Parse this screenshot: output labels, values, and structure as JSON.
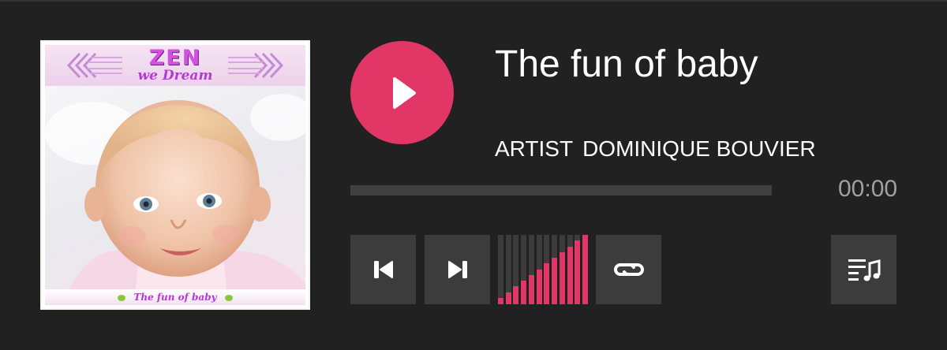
{
  "track": {
    "title": "The fun of baby",
    "artist_label": "ARTIST",
    "artist_name": "DOMINIQUE BOUVIER",
    "time": "00:00",
    "progress": 0
  },
  "cover": {
    "brand_line1": "ZEN",
    "brand_line2": "we Dream",
    "footer_text": "The fun of baby"
  },
  "controls": {
    "play_icon": "play-icon",
    "prev_icon": "skip-previous-icon",
    "next_icon": "skip-next-icon",
    "repeat_icon": "repeat-icon",
    "playlist_icon": "playlist-icon"
  },
  "volume": {
    "bars": 12,
    "level_fraction": 1.0
  },
  "colors": {
    "background": "#212121",
    "accent": "#e23766",
    "button_bg": "#3c3c3c",
    "track_bg": "#404040",
    "time_text": "#a0a0a0"
  }
}
